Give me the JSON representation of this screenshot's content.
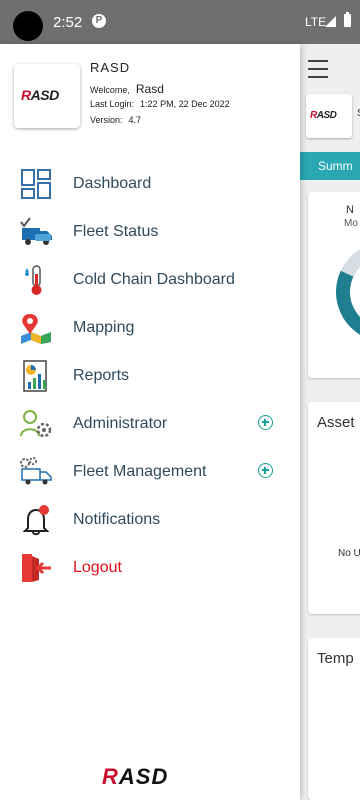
{
  "status_bar": {
    "time": "2:52",
    "network": "LTE"
  },
  "drawer": {
    "logo_text": "RASD",
    "app_name": "RASD",
    "welcome_label": "Welcome,",
    "welcome_value": "Rasd",
    "last_login_label": "Last Login:",
    "last_login_value": "1:22 PM, 22 Dec 2022",
    "version_label": "Version:",
    "version_value": "4.7",
    "menu": [
      {
        "label": "Dashboard",
        "icon": "dashboard-icon"
      },
      {
        "label": "Fleet Status",
        "icon": "fleet-status-icon"
      },
      {
        "label": "Cold Chain Dashboard",
        "icon": "thermometer-icon"
      },
      {
        "label": "Mapping",
        "icon": "map-pin-icon"
      },
      {
        "label": "Reports",
        "icon": "report-icon"
      },
      {
        "label": "Administrator",
        "icon": "admin-icon",
        "expandable": true
      },
      {
        "label": "Fleet Management",
        "icon": "fleet-management-icon",
        "expandable": true
      },
      {
        "label": "Notifications",
        "icon": "bell-icon"
      },
      {
        "label": "Logout",
        "icon": "logout-icon",
        "accent": "#e0101a"
      }
    ],
    "footer_logo": "RASD"
  },
  "background": {
    "logo_text": "RASD",
    "tab_label": "Summ",
    "card1_title": "N",
    "card1_sub": "Mo",
    "card2_title": "Asset",
    "card2_text": "No U",
    "card3_title": "Temp",
    "partial_text": "S"
  },
  "colors": {
    "accent": "#29a8b4",
    "brand_red": "#c8102e",
    "menu_text": "#2f4a5c"
  }
}
